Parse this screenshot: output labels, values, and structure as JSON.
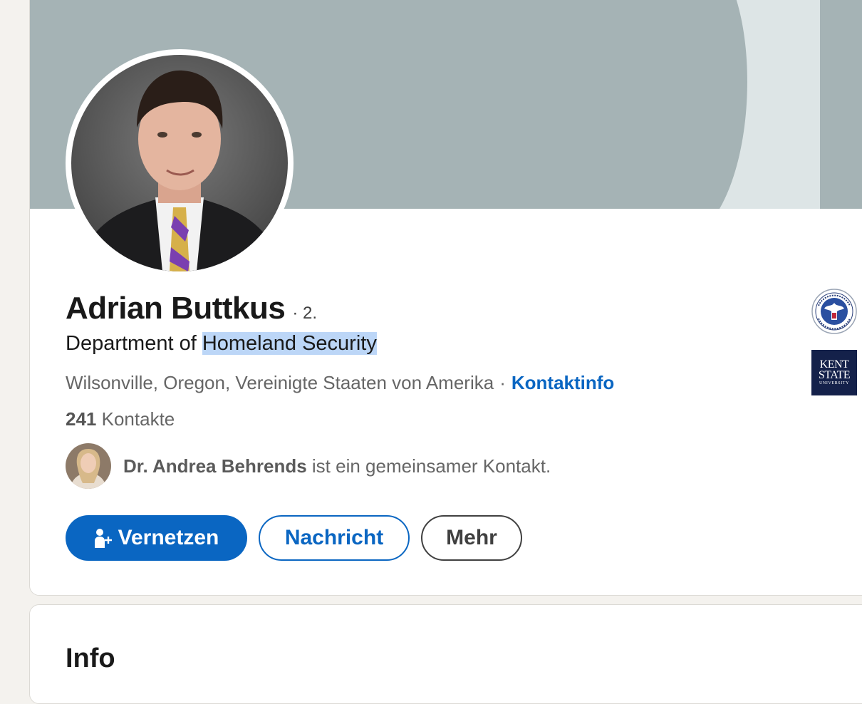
{
  "profile": {
    "name": "Adrian Buttkus",
    "degree": "· 2.",
    "headline_prefix": "Department of ",
    "headline_highlight": "Homeland Security",
    "location": "Wilsonville, Oregon, Vereinigte Staaten von Amerika",
    "separator": "·",
    "contact_info_label": "Kontaktinfo",
    "connections_count": "241",
    "connections_label": "Kontakte",
    "mutual_name": "Dr. Andrea Behrends",
    "mutual_suffix": "ist ein gemeinsamer Kontakt."
  },
  "actions": {
    "connect_label": "Vernetzen",
    "message_label": "Nachricht",
    "more_label": "Mehr"
  },
  "logos": {
    "education_line1": "KENT",
    "education_line2": "STATE",
    "education_line3": "UNIVERSITY"
  },
  "info": {
    "title": "Info"
  },
  "colors": {
    "accent": "#0a66c2",
    "banner_dark": "#a5b3b5",
    "banner_light": "#dde5e6",
    "highlight": "#bcd6f7",
    "page_bg": "#f4f2ee"
  }
}
